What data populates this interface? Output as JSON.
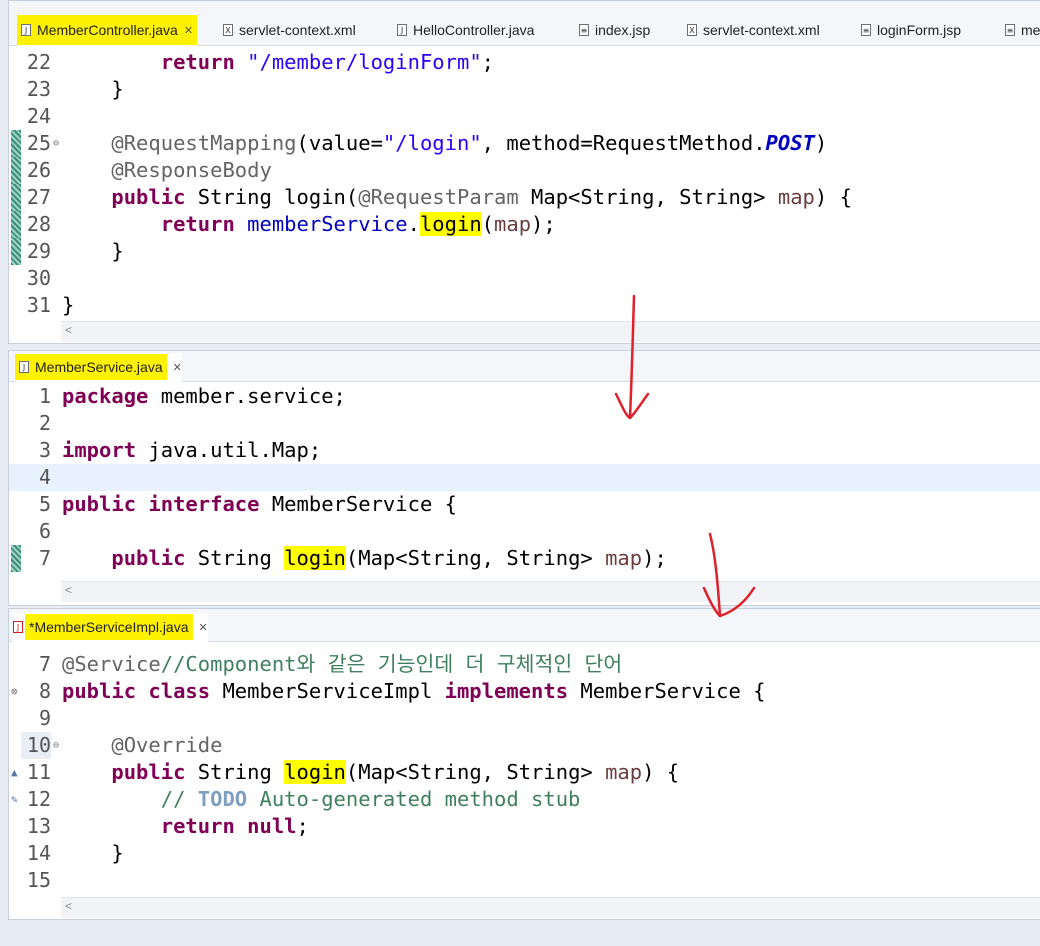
{
  "top_tabs": [
    {
      "label": "MemberController.java",
      "icon": "java-file-icon",
      "active": true
    },
    {
      "label": "servlet-context.xml",
      "icon": "xml-file-icon"
    },
    {
      "label": "HelloController.java",
      "icon": "java-file-icon"
    },
    {
      "label": "index.jsp",
      "icon": "jsp-file-icon"
    },
    {
      "label": "servlet-context.xml",
      "icon": "xml-file-icon"
    },
    {
      "label": "loginForm.jsp",
      "icon": "jsp-file-icon"
    },
    {
      "label": "me",
      "icon": "jsp-file-icon"
    }
  ],
  "pane1": {
    "lines": [
      {
        "n": "22",
        "t": "        return \"/member/loginForm\";"
      },
      {
        "n": "23",
        "t": "    }"
      },
      {
        "n": "24",
        "t": ""
      },
      {
        "n": "25",
        "t": "    @RequestMapping(value=\"/login\", method=RequestMethod.POST)"
      },
      {
        "n": "26",
        "t": "    @ResponseBody"
      },
      {
        "n": "27",
        "t": "    public String login(@RequestParam Map<String, String> map) {"
      },
      {
        "n": "28",
        "t": "        return memberService.login(map);"
      },
      {
        "n": "29",
        "t": "    }"
      },
      {
        "n": "30",
        "t": ""
      },
      {
        "n": "31",
        "t": "}"
      }
    ]
  },
  "pane2": {
    "tab": "MemberService.java",
    "lines": [
      {
        "n": "1",
        "t": "package member.service;"
      },
      {
        "n": "2",
        "t": ""
      },
      {
        "n": "3",
        "t": "import java.util.Map;"
      },
      {
        "n": "4",
        "t": ""
      },
      {
        "n": "5",
        "t": "public interface MemberService {"
      },
      {
        "n": "6",
        "t": ""
      },
      {
        "n": "7",
        "t": "    public String login(Map<String, String> map);"
      }
    ]
  },
  "pane3": {
    "tab": "*MemberServiceImpl.java",
    "lines": [
      {
        "n": "7",
        "t": "@Service//Component와 같은 기능인데 더 구체적인 단어"
      },
      {
        "n": "8",
        "t": "public class MemberServiceImpl implements MemberService {"
      },
      {
        "n": "9",
        "t": ""
      },
      {
        "n": "10",
        "t": "    @Override"
      },
      {
        "n": "11",
        "t": "    public String login(Map<String, String> map) {"
      },
      {
        "n": "12",
        "t": "        // TODO Auto-generated method stub"
      },
      {
        "n": "13",
        "t": "        return null;"
      },
      {
        "n": "14",
        "t": "    }"
      },
      {
        "n": "15",
        "t": ""
      }
    ]
  },
  "colors": {
    "highlight": "#ffff00",
    "keyword": "#7f0055",
    "string": "#2a00ff",
    "annotation_arrow": "#e0202a"
  }
}
